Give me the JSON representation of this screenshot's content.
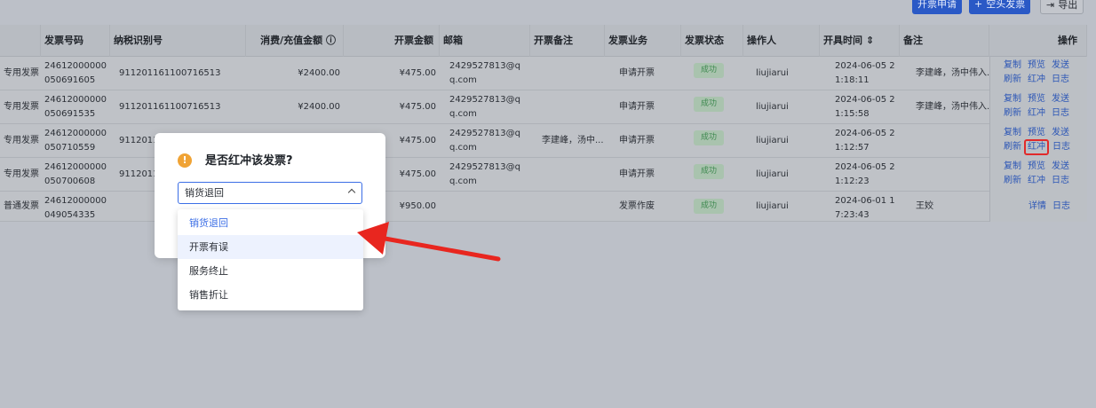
{
  "toolbar": {
    "apply_label": "开票申请",
    "blank_label": "空头发票",
    "export_label": "导出"
  },
  "table": {
    "headers": [
      "发票号码",
      "纳税识别号",
      "消费/充值金额",
      "开票金额",
      "邮箱",
      "开票备注",
      "发票业务",
      "发票状态",
      "操作人",
      "开具时间",
      "备注",
      "操作"
    ],
    "rows": [
      {
        "type": "专用发票",
        "invoice_no": "24612000000050691605",
        "tax_id": "911201161100716513",
        "consume": "¥2400.00",
        "amount": "¥475.00",
        "email": "2429527813@qq.com",
        "note": "",
        "business": "申请开票",
        "status": "成功",
        "operator": "liujiarui",
        "time": "2024-06-05 21:18:11",
        "remark": "李建峰，汤中伟入...",
        "ops": [
          "复制",
          "预览",
          "发送",
          "刷新",
          "红冲",
          "日志"
        ]
      },
      {
        "type": "专用发票",
        "invoice_no": "24612000000050691535",
        "tax_id": "911201161100716513",
        "consume": "¥2400.00",
        "amount": "¥475.00",
        "email": "2429527813@qq.com",
        "note": "",
        "business": "申请开票",
        "status": "成功",
        "operator": "liujiarui",
        "time": "2024-06-05 21:15:58",
        "remark": "李建峰，汤中伟入...",
        "ops": [
          "复制",
          "预览",
          "发送",
          "刷新",
          "红冲",
          "日志"
        ]
      },
      {
        "type": "专用发票",
        "invoice_no": "24612000000050710559",
        "tax_id": "91120116",
        "consume": "",
        "amount": "¥475.00",
        "email": "2429527813@qq.com",
        "note": "李建峰，汤中...",
        "business": "申请开票",
        "status": "成功",
        "operator": "liujiarui",
        "time": "2024-06-05 21:12:57",
        "remark": "",
        "ops": [
          "复制",
          "预览",
          "发送",
          "刷新",
          "红冲",
          "日志"
        ]
      },
      {
        "type": "专用发票",
        "invoice_no": "24612000000050700608",
        "tax_id": "91120116",
        "consume": "",
        "amount": "¥475.00",
        "email": "2429527813@qq.com",
        "note": "",
        "business": "申请开票",
        "status": "成功",
        "operator": "liujiarui",
        "time": "2024-06-05 21:12:23",
        "remark": "",
        "ops": [
          "复制",
          "预览",
          "发送",
          "刷新",
          "红冲",
          "日志"
        ]
      },
      {
        "type": "普通发票",
        "invoice_no": "24612000000049054335",
        "tax_id": "",
        "consume": "",
        "amount": "¥950.00",
        "email": "",
        "note": "",
        "business": "发票作废",
        "status": "成功",
        "operator": "liujiarui",
        "time": "2024-06-01 17:23:43",
        "remark": "王姣",
        "ops": [
          "详情",
          "日志"
        ]
      }
    ]
  },
  "modal": {
    "title": "是否红冲该发票?",
    "selected": "销货退回",
    "options": [
      "销货退回",
      "开票有误",
      "服务终止",
      "销售折让"
    ]
  },
  "colors": {
    "primary": "#2a59c6",
    "link": "#2c56b6",
    "highlight": "#e12a2a",
    "warning": "#f0a335"
  }
}
